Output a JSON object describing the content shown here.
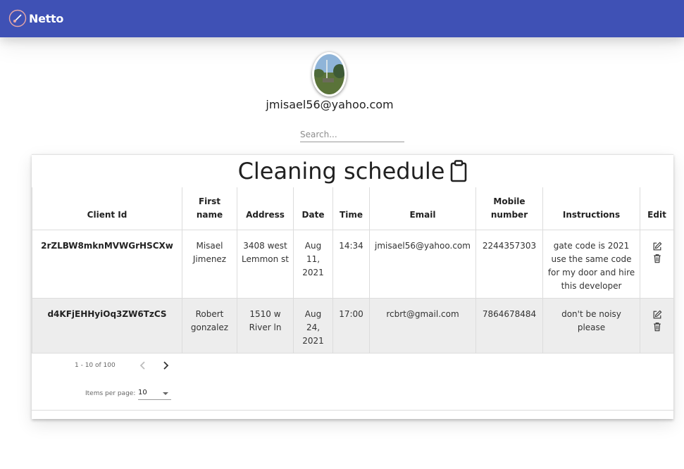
{
  "app": {
    "name": "Netto"
  },
  "profile": {
    "email": "jmisael56@yahoo.com"
  },
  "search": {
    "placeholder": "Search..."
  },
  "schedule": {
    "title": "Cleaning schedule",
    "columns": [
      "Client Id",
      "First name",
      "Address",
      "Date",
      "Time",
      "Email",
      "Mobile number",
      "Instructions",
      "Edit"
    ],
    "rows": [
      {
        "client_id": "2rZLBW8mknMVWGrHSCXw",
        "first_name": "Misael Jimenez",
        "address": "3408 west Lemmon st",
        "date": "Aug 11, 2021",
        "time": "14:34",
        "email": "jmisael56@yahoo.com",
        "mobile": "2244357303",
        "instructions": "gate code is 2021 use the same code for my door and hire this developer"
      },
      {
        "client_id": "d4KFjEHHyiOq3ZW6TzCS",
        "first_name": "Robert gonzalez",
        "address": "1510 w River ln",
        "date": "Aug 24, 2021",
        "time": "17:00",
        "email": "rcbrt@gmail.com",
        "mobile": "7864678484",
        "instructions": "don't be noisy please"
      }
    ]
  },
  "paginator": {
    "range_label": "1 - 10 of 100",
    "items_per_page_label": "Items per page:",
    "items_per_page_value": "10"
  },
  "icons": {
    "brand": "broom-logo-icon",
    "title": "clipboard-icon",
    "edit": "edit-icon",
    "delete": "trash-icon",
    "prev": "chevron-left-icon",
    "next": "chevron-right-icon"
  },
  "colors": {
    "primary": "#3f51b5",
    "row_alt": "#ededed"
  }
}
